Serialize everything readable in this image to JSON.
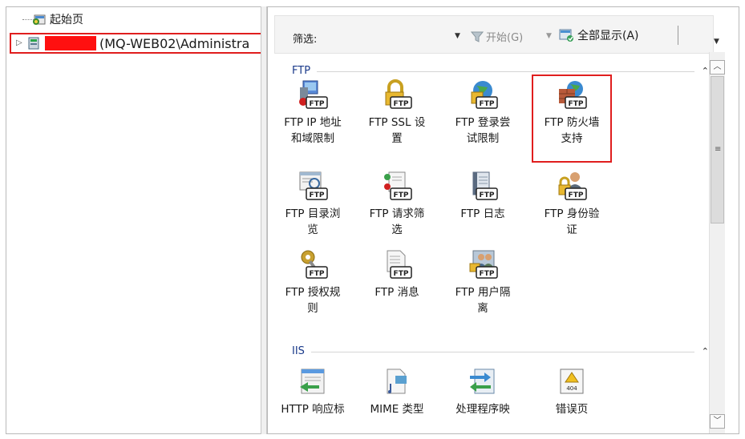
{
  "tree": {
    "start_page": "起始页",
    "server_label": "(MQ-WEB02\\Administra"
  },
  "filter_bar": {
    "filter_label": "筛选:",
    "start_button": "开始(G)",
    "show_all_button": "全部显示(A)"
  },
  "groups": {
    "ftp": {
      "title": "FTP",
      "features": [
        {
          "line1": "FTP IP 地址",
          "line2": "和域限制",
          "icon": "ftp-ip-restrictions-icon"
        },
        {
          "line1": "FTP SSL 设",
          "line2": "置",
          "icon": "ftp-ssl-lock-icon"
        },
        {
          "line1": "FTP 登录尝",
          "line2": "试限制",
          "icon": "ftp-logon-attempt-icon"
        },
        {
          "line1": "FTP 防火墙",
          "line2": "支持",
          "icon": "ftp-firewall-icon"
        },
        {
          "line1": "FTP 目录浏",
          "line2": "览",
          "icon": "ftp-directory-browsing-icon"
        },
        {
          "line1": "FTP 请求筛",
          "line2": "选",
          "icon": "ftp-request-filtering-icon"
        },
        {
          "line1": "FTP 日志",
          "line2": "",
          "icon": "ftp-logging-icon"
        },
        {
          "line1": "FTP 身份验",
          "line2": "证",
          "icon": "ftp-authentication-icon"
        },
        {
          "line1": "FTP 授权规",
          "line2": "则",
          "icon": "ftp-authorization-key-icon"
        },
        {
          "line1": "FTP 消息",
          "line2": "",
          "icon": "ftp-messages-icon"
        },
        {
          "line1": "FTP 用户隔",
          "line2": "离",
          "icon": "ftp-user-isolation-icon"
        }
      ]
    },
    "iis": {
      "title": "IIS",
      "features": [
        {
          "line1": "HTTP 响应标",
          "icon": "http-response-headers-icon"
        },
        {
          "line1": "MIME 类型",
          "icon": "mime-types-icon"
        },
        {
          "line1": "处理程序映",
          "icon": "handler-mappings-icon"
        },
        {
          "line1": "错误页",
          "icon": "error-pages-icon"
        }
      ]
    }
  },
  "colors": {
    "highlight_red": "#e01e1e",
    "group_title": "#1a3a8a"
  }
}
